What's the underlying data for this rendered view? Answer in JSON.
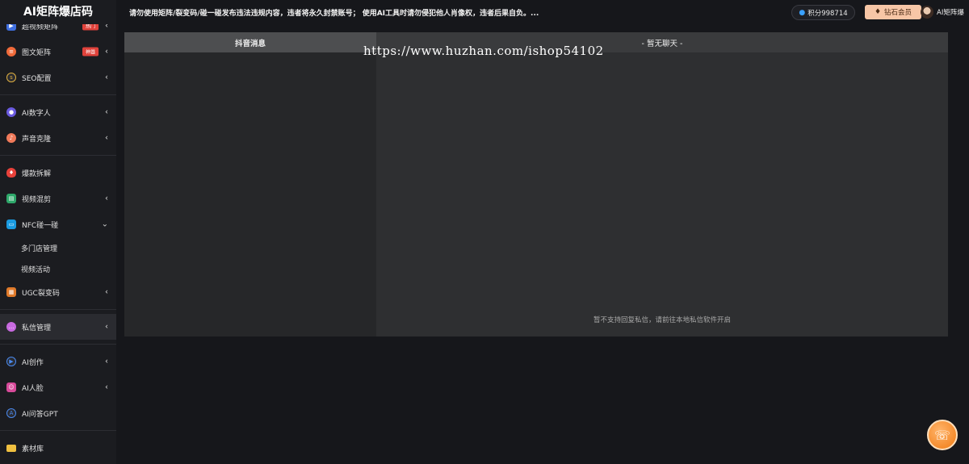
{
  "app": {
    "title": "AI矩阵爆店码"
  },
  "sidebar": {
    "items": [
      {
        "label": "超视频矩阵",
        "icon": "video-matrix-icon",
        "badge": "热门",
        "has_chevron": true
      },
      {
        "label": "图文矩阵",
        "icon": "image-text-icon",
        "badge": "神器",
        "has_chevron": true
      },
      {
        "label": "SEO配置",
        "icon": "seo-icon",
        "has_chevron": true
      },
      {
        "label": "AI数字人",
        "icon": "digital-human-icon",
        "has_chevron": true
      },
      {
        "label": "声音克隆",
        "icon": "voice-clone-icon",
        "has_chevron": true
      },
      {
        "label": "爆款拆解",
        "icon": "fire-icon",
        "has_chevron": false
      },
      {
        "label": "视频混剪",
        "icon": "clapperboard-icon",
        "has_chevron": true
      },
      {
        "label": "NFC碰一碰",
        "icon": "nfc-icon",
        "has_chevron": true,
        "expanded": true
      },
      {
        "label": "多门店管理",
        "sub": true
      },
      {
        "label": "视频活动",
        "sub": true
      },
      {
        "label": "UGC裂变码",
        "icon": "qrcode-icon",
        "has_chevron": true
      },
      {
        "label": "私信管理",
        "icon": "message-icon",
        "has_chevron": true,
        "active": true
      },
      {
        "label": "AI创作",
        "icon": "play-icon",
        "has_chevron": true
      },
      {
        "label": "AI人脸",
        "icon": "face-icon",
        "has_chevron": true
      },
      {
        "label": "AI问答GPT",
        "icon": "ai-chat-icon",
        "has_chevron": false
      },
      {
        "label": "素材库",
        "icon": "folder-icon",
        "has_chevron": false
      }
    ],
    "chevron_down": "⌄",
    "chevron_left": "‹"
  },
  "topbar": {
    "notice": "请勿使用矩阵/裂变码/碰一碰发布违法违规内容，违者将永久封禁账号； 使用AI工具时请勿侵犯他人肖像权，违者后果自负。...",
    "points_label": "积分998714",
    "vip_label": "钻石会员",
    "username": "AI矩阵爆"
  },
  "panel": {
    "left_header": "抖音消息",
    "right_header": "- 暂无聊天 -",
    "hint": "暂不支持回复私信，请前往本地私信软件开启"
  },
  "watermark": "https://www.huzhan.com/ishop54102",
  "colors": {
    "background": "#16171b",
    "sidebar": "#1b1c20",
    "vip": "#f7c6a6",
    "badge": "#e0423b",
    "support": "#f07a12"
  }
}
